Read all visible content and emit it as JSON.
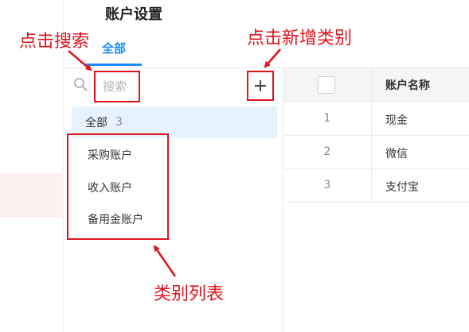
{
  "header": {
    "title": "账户设置",
    "tabs": [
      {
        "label": "全部",
        "active": true
      }
    ]
  },
  "category_panel": {
    "search": {
      "placeholder": "搜索",
      "value": ""
    },
    "add_icon": "plus-icon",
    "all": {
      "label": "全部",
      "count": "3"
    },
    "categories": [
      "采购账户",
      "收入账户",
      "备用金账户"
    ]
  },
  "table": {
    "columns": [
      "",
      "账户名称"
    ],
    "rows": [
      {
        "index": "1",
        "name": "现金"
      },
      {
        "index": "2",
        "name": "微信"
      },
      {
        "index": "3",
        "name": "支付宝"
      }
    ]
  },
  "annotations": {
    "search": "点击搜索",
    "add": "点击新增类别",
    "list": "类别列表"
  },
  "colors": {
    "accent": "#1a8cff",
    "annotation_red": "#e0141e",
    "selected_bg": "#e6f2fd"
  }
}
